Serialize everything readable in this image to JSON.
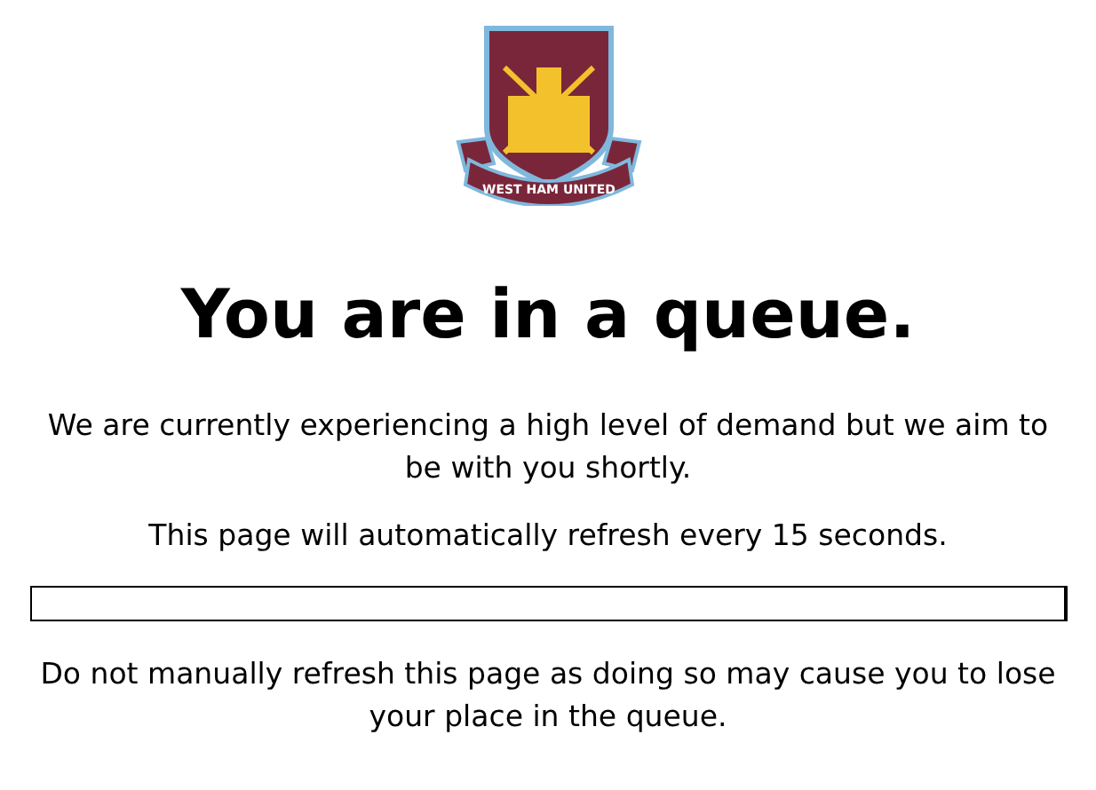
{
  "logo": {
    "banner": "WEST HAM UNITED"
  },
  "heading": "You are in a queue.",
  "paragraphs": [
    "We are currently experiencing a high level of demand but we aim to be with you shortly.",
    "This page will automatically refresh every 15 seconds."
  ],
  "notice": "Do not manually refresh this page as doing so may cause you to lose your place in the queue."
}
